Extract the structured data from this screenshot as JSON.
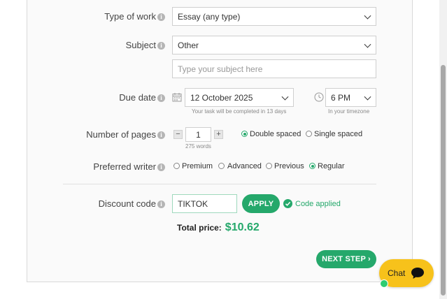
{
  "form": {
    "type_of_work": {
      "label": "Type of work",
      "value": "Essay (any type)"
    },
    "subject": {
      "label": "Subject",
      "value": "Other",
      "custom_placeholder": "Type your subject here"
    },
    "due_date": {
      "label": "Due date",
      "date": "12 October 2025",
      "date_hint": "Your task will be completed in 13 days",
      "time": "6 PM",
      "time_hint": "In your timezone"
    },
    "pages": {
      "label": "Number of pages",
      "minus": "−",
      "value": "1",
      "plus": "+",
      "words": "275 words",
      "spacing_options": [
        "Double spaced",
        "Single spaced"
      ],
      "spacing_selected": "Double spaced"
    },
    "preferred_writer": {
      "label": "Preferred writer",
      "options": [
        "Premium",
        "Advanced",
        "Previous",
        "Regular"
      ],
      "selected": "Regular"
    },
    "discount": {
      "label": "Discount code",
      "value": "TIKTOK",
      "apply_label": "APPLY",
      "status": "Code applied"
    },
    "total": {
      "label": "Total price:",
      "value": "$10.62"
    },
    "next_label": "NEXT STEP ›"
  },
  "chat": {
    "label": "Chat"
  },
  "colors": {
    "accent": "#25a86b",
    "chat_bg": "#f7c21b",
    "field_border": "#cfcfcf"
  }
}
